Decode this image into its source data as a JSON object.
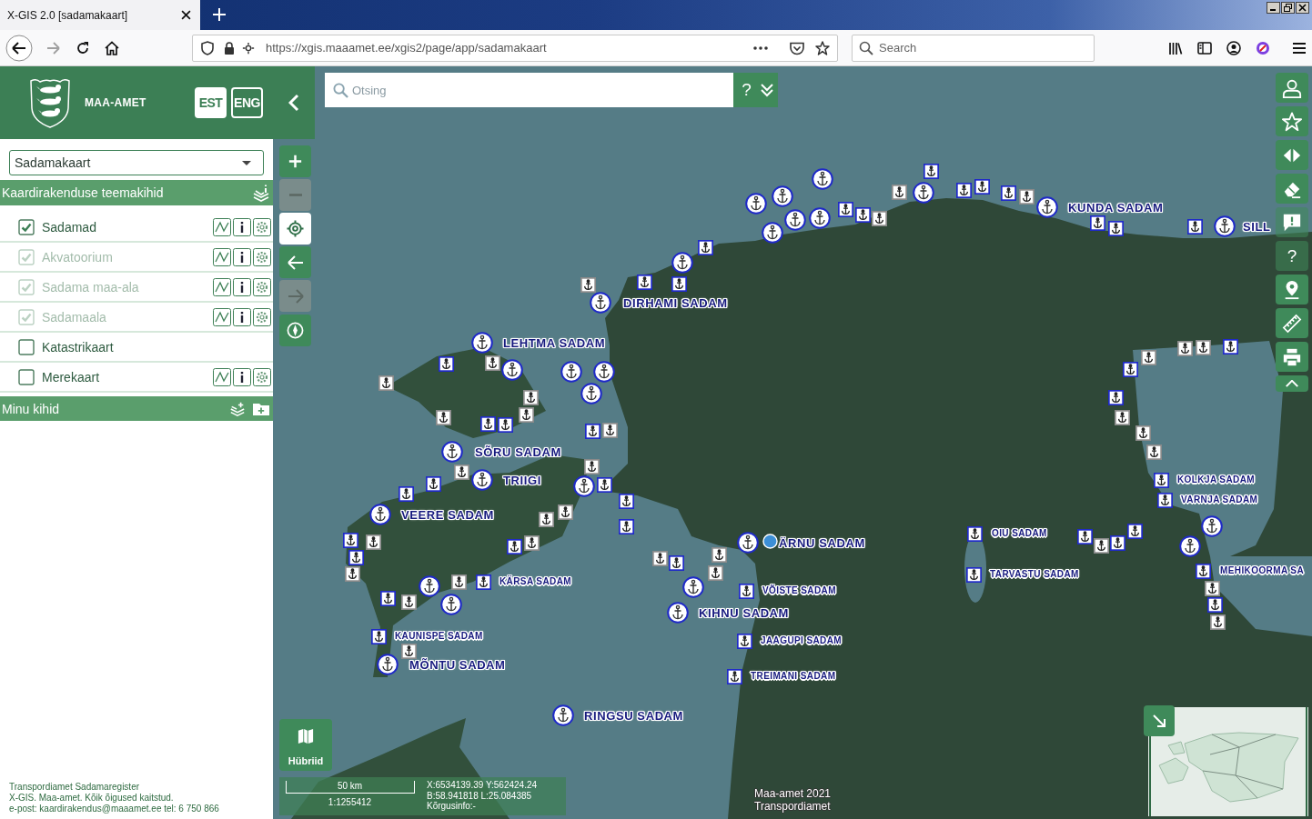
{
  "browser": {
    "tab_title": "X-GIS 2.0 [sadamakaart]",
    "forward_disabled": true,
    "url": "https://xgis.maaamet.ee/xgis2/page/app/sadamakaart",
    "search_placeholder": "Search"
  },
  "header": {
    "agency": "MAA-AMET",
    "languages": [
      {
        "label": "EST",
        "selected": true
      },
      {
        "label": "ENG",
        "selected": false
      }
    ]
  },
  "map_selector": {
    "value": "Sadamakaart"
  },
  "theme_layers": {
    "title": "Kaardirakenduse teemakihid",
    "layers": [
      {
        "label": "Sadamad",
        "checked": true,
        "disabled": false,
        "tools": true
      },
      {
        "label": "Akvatoorium",
        "checked": true,
        "disabled": true,
        "tools": true
      },
      {
        "label": "Sadama maa-ala",
        "checked": true,
        "disabled": true,
        "tools": true
      },
      {
        "label": "Sadamaala",
        "checked": true,
        "disabled": true,
        "tools": true
      },
      {
        "label": "Katastrikaart",
        "checked": false,
        "disabled": false,
        "tools": false
      },
      {
        "label": "Merekaart",
        "checked": false,
        "disabled": false,
        "tools": true
      }
    ]
  },
  "my_layers": {
    "title": "Minu kihid"
  },
  "footer": [
    "Transpordiamet Sadamaregister",
    "X-GIS. Maa-amet. Kõik õigused kaitstud.",
    "e-post: kaardirakendus@maaamet.ee tel: 6 750 866"
  ],
  "search": {
    "placeholder": "Otsing",
    "help": "?"
  },
  "map_controls": [
    {
      "kind": "zoom-in",
      "disabled": false,
      "selected": false
    },
    {
      "kind": "zoom-out",
      "disabled": true,
      "selected": false
    },
    {
      "kind": "locate",
      "disabled": false,
      "selected": true
    },
    {
      "kind": "back",
      "disabled": false,
      "selected": false
    },
    {
      "kind": "forward",
      "disabled": true,
      "selected": false
    },
    {
      "kind": "compass",
      "disabled": false,
      "selected": false
    }
  ],
  "toolbar": [
    {
      "kind": "user",
      "faded": false
    },
    {
      "kind": "star",
      "faded": false
    },
    {
      "kind": "swap",
      "faded": false
    },
    {
      "kind": "eraser",
      "faded": false
    },
    {
      "kind": "comment",
      "faded": true
    },
    {
      "kind": "help",
      "faded": true,
      "label": "?"
    },
    {
      "kind": "pin",
      "faded": false
    },
    {
      "kind": "ruler",
      "faded": false
    },
    {
      "kind": "print",
      "faded": false
    },
    {
      "kind": "collapse",
      "faded": false
    }
  ],
  "harbors": [
    {
      "name": "KUNDA SADAM",
      "kind": "circle"
    },
    {
      "name": "SILL",
      "kind": "circle"
    },
    {
      "name": "DIRHAMI SADAM",
      "kind": "circle"
    },
    {
      "name": "LEHTMA SADAM",
      "kind": "circle"
    },
    {
      "name": "SÕRU SADAM",
      "kind": "circle"
    },
    {
      "name": "TRIIGI",
      "kind": "circle"
    },
    {
      "name": "KOLKJA SADAM",
      "kind": "square"
    },
    {
      "name": "VARNJA SADAM",
      "kind": "square"
    },
    {
      "name": "VEERE SADAM",
      "kind": "circle"
    },
    {
      "name": "OIU SADAM",
      "kind": "square"
    },
    {
      "name": "ÄRNU SADAM",
      "kind": "circle"
    },
    {
      "name": "TARVASTU SADAM",
      "kind": "square"
    },
    {
      "name": "MEHIKOORMA SA",
      "kind": "square"
    },
    {
      "name": "KÄRSA SADAM",
      "kind": "square"
    },
    {
      "name": "VÕISTE SADAM",
      "kind": "square"
    },
    {
      "name": "KIHNU SADAM",
      "kind": "circle"
    },
    {
      "name": "KAUNISPE SADAM",
      "kind": "square"
    },
    {
      "name": "JAAGUPI SADAM",
      "kind": "square"
    },
    {
      "name": "MÕNTU SADAM",
      "kind": "circle"
    },
    {
      "name": "TREIMANI SADAM",
      "kind": "square"
    },
    {
      "name": "RINGSU SADAM",
      "kind": "circle"
    }
  ],
  "basemap_button": {
    "label": "Hübriid"
  },
  "scale": {
    "distance": "50 km",
    "ratio": "1:1255412"
  },
  "coordinates": [
    "X:6534139.39 Y:562424.24",
    "B:58.941818 L:25.084385",
    "Kõrgusinfo:-"
  ],
  "attribution": [
    "Maa-amet 2021",
    "Transpordiamet"
  ]
}
